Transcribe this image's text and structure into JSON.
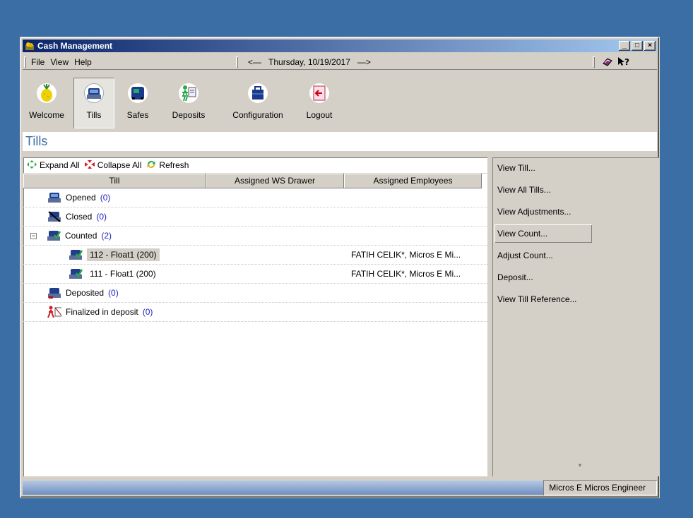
{
  "window": {
    "title": "Cash Management"
  },
  "menu": {
    "items": [
      "File",
      "View",
      "Help"
    ]
  },
  "nav": {
    "prev": "<—",
    "date": "Thursday, 10/19/2017",
    "next": "—>"
  },
  "toolbar": {
    "buttons": [
      {
        "label": "Welcome",
        "icon": "welcome-icon"
      },
      {
        "label": "Tills",
        "icon": "tills-icon"
      },
      {
        "label": "Safes",
        "icon": "safes-icon"
      },
      {
        "label": "Deposits",
        "icon": "deposits-icon"
      },
      {
        "label": "Configuration",
        "icon": "configuration-icon"
      },
      {
        "label": "Logout",
        "icon": "logout-icon"
      }
    ],
    "active": "Tills"
  },
  "section": {
    "title": "Tills"
  },
  "tree_toolbar": {
    "expand": "Expand All",
    "collapse": "Collapse All",
    "refresh": "Refresh"
  },
  "columns": [
    "Till",
    "Assigned WS Drawer",
    "Assigned Employees"
  ],
  "tree": [
    {
      "label": "Opened",
      "count": "(0)"
    },
    {
      "label": "Closed",
      "count": "(0)"
    },
    {
      "label": "Counted",
      "count": "(2)",
      "expander": "−"
    },
    {
      "label": "112 - Float1 (200)",
      "employees": "FATIH CELIK*, Micros E Mi..."
    },
    {
      "label": "111 - Float1 (200)",
      "employees": "FATIH CELIK*, Micros E Mi..."
    },
    {
      "label": "Deposited",
      "count": "(0)"
    },
    {
      "label": "Finalized in deposit",
      "count": "(0)"
    }
  ],
  "actions": [
    "View Till...",
    "View All Tills...",
    "View Adjustments...",
    "View Count...",
    "Adjust Count...",
    "Deposit...",
    "View Till Reference..."
  ],
  "status": {
    "user": "Micros E Micros Engineer"
  },
  "colors": {
    "desktop": "#3a6ea5",
    "title_start": "#0a246a",
    "title_end": "#a6caf0",
    "header_text": "#3a6ea5",
    "count": "#2020c0"
  }
}
